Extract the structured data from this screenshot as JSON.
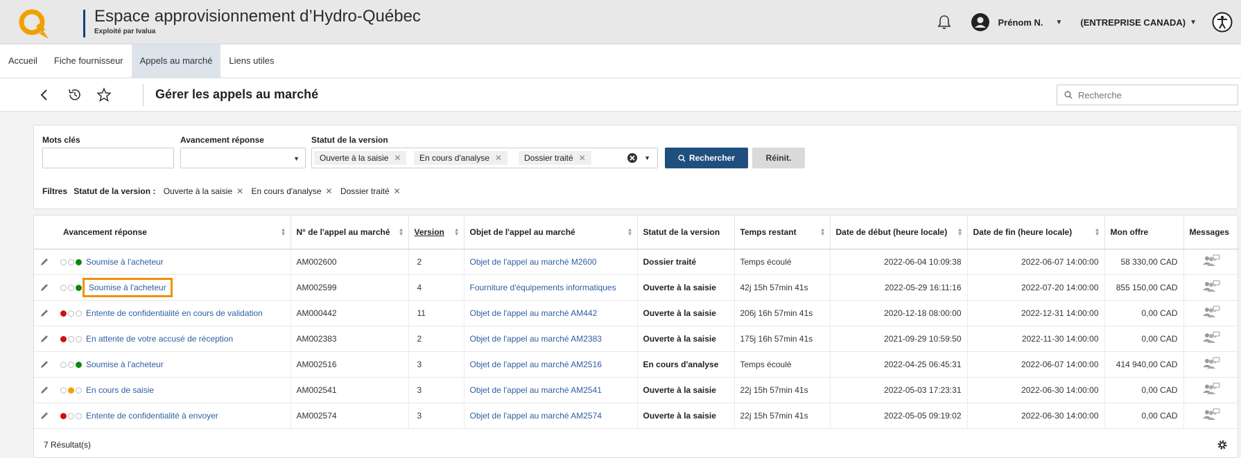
{
  "header": {
    "title": "Espace approvisionnement d’Hydro-Québec",
    "subtitle": "Exploité par Ivalua",
    "user_name": "Prénom N.",
    "company": "(ENTREPRISE CANADA)",
    "brand_color": "#f0a000",
    "icons": [
      "hydro-quebec-logo",
      "bell-icon",
      "user-avatar-icon",
      "accessibility-icon"
    ]
  },
  "nav": {
    "tabs": [
      {
        "label": "Accueil"
      },
      {
        "label": "Fiche fournisseur"
      },
      {
        "label": "Appels au marché"
      },
      {
        "label": "Liens utiles"
      }
    ],
    "active": "Appels au marché"
  },
  "toolbar": {
    "page_title": "Gérer les appels au marché",
    "search_placeholder": "Recherche",
    "icons": [
      "back-icon",
      "history-icon",
      "star-icon",
      "search-icon"
    ]
  },
  "filters": {
    "keywords_label": "Mots clés",
    "keywords_value": "",
    "progress_label": "Avancement réponse",
    "progress_value": "",
    "status_label": "Statut de la version",
    "status_tags": [
      "Ouverte à la saisie",
      "En cours d'analyse",
      "Dossier traité"
    ],
    "search_button": "Rechercher",
    "reset_button": "Réinit.",
    "active_prefix": "Filtres",
    "active_label": "Statut de la version :",
    "active_tags": [
      "Ouverte à la saisie",
      "En cours d'analyse",
      "Dossier traité"
    ],
    "accent_color": "#1f4f7f"
  },
  "table": {
    "columns": [
      "Avancement réponse",
      "N° de l'appel au marché",
      "Version",
      "Objet de l'appel au marché",
      "Statut de la version",
      "Temps restant",
      "Date de début (heure locale)",
      "Date de fin (heure locale)",
      "Mon offre",
      "Messages"
    ],
    "rows": [
      {
        "dots": [
          "empty",
          "empty",
          "green"
        ],
        "progress": "Soumise à l'acheteur",
        "number": "AM002600",
        "version": "2",
        "object": "Objet de l'appel au marché M2600",
        "status": "Dossier traité",
        "remaining": "Temps écoulé",
        "start": "2022-06-04 10:09:38",
        "end": "2022-06-07 14:00:00",
        "offer": "58 330,00 CAD",
        "highlight": false
      },
      {
        "dots": [
          "empty",
          "empty",
          "green"
        ],
        "progress": "Soumise à l'acheteur",
        "number": "AM002599",
        "version": "4",
        "object": "Fourniture d'équipements informatiques",
        "status": "Ouverte à la saisie",
        "remaining": "42j 15h 57min 41s",
        "start": "2022-05-29 16:11:16",
        "end": "2022-07-20 14:00:00",
        "offer": "855 150,00 CAD",
        "highlight": true
      },
      {
        "dots": [
          "red",
          "empty",
          "empty"
        ],
        "progress": "Entente de confidentialité en cours de validation",
        "number": "AM000442",
        "version": "11",
        "object": "Objet de l'appel au marché AM442",
        "status": "Ouverte à la saisie",
        "remaining": "206j 16h 57min 41s",
        "start": "2020-12-18 08:00:00",
        "end": "2022-12-31 14:00:00",
        "offer": "0,00 CAD",
        "highlight": false
      },
      {
        "dots": [
          "red",
          "empty",
          "empty"
        ],
        "progress": "En attente de votre accusé de réception",
        "number": "AM002383",
        "version": "2",
        "object": "Objet de l'appel au marché AM2383",
        "status": "Ouverte à la saisie",
        "remaining": "175j 16h 57min 41s",
        "start": "2021-09-29 10:59:50",
        "end": "2022-11-30 14:00:00",
        "offer": "0,00 CAD",
        "highlight": false
      },
      {
        "dots": [
          "empty",
          "empty",
          "green"
        ],
        "progress": "Soumise à l'acheteur",
        "number": "AM002516",
        "version": "3",
        "object": "Objet de l'appel au marché AM2516",
        "status": "En cours d'analyse",
        "remaining": "Temps écoulé",
        "start": "2022-04-25 06:45:31",
        "end": "2022-06-07 14:00:00",
        "offer": "414 940,00 CAD",
        "highlight": false
      },
      {
        "dots": [
          "empty",
          "orange",
          "empty"
        ],
        "progress": "En cours de saisie",
        "number": "AM002541",
        "version": "3",
        "object": "Objet de l'appel au marché AM2541",
        "status": "Ouverte à la saisie",
        "remaining": "22j 15h 57min 41s",
        "start": "2022-05-03 17:23:31",
        "end": "2022-06-30 14:00:00",
        "offer": "0,00 CAD",
        "highlight": false
      },
      {
        "dots": [
          "red",
          "empty",
          "empty"
        ],
        "progress": "Entente de confidentialité à envoyer",
        "number": "AM002574",
        "version": "3",
        "object": "Objet de l'appel au marché AM2574",
        "status": "Ouverte à la saisie",
        "remaining": "22j 15h 57min 41s",
        "start": "2022-05-05 09:19:02",
        "end": "2022-06-30 14:00:00",
        "offer": "0,00 CAD",
        "highlight": false
      }
    ],
    "result_count": "7 Résultat(s)",
    "row_icons": [
      "pencil-icon",
      "messages-icon",
      "settings-gear-icon"
    ]
  }
}
